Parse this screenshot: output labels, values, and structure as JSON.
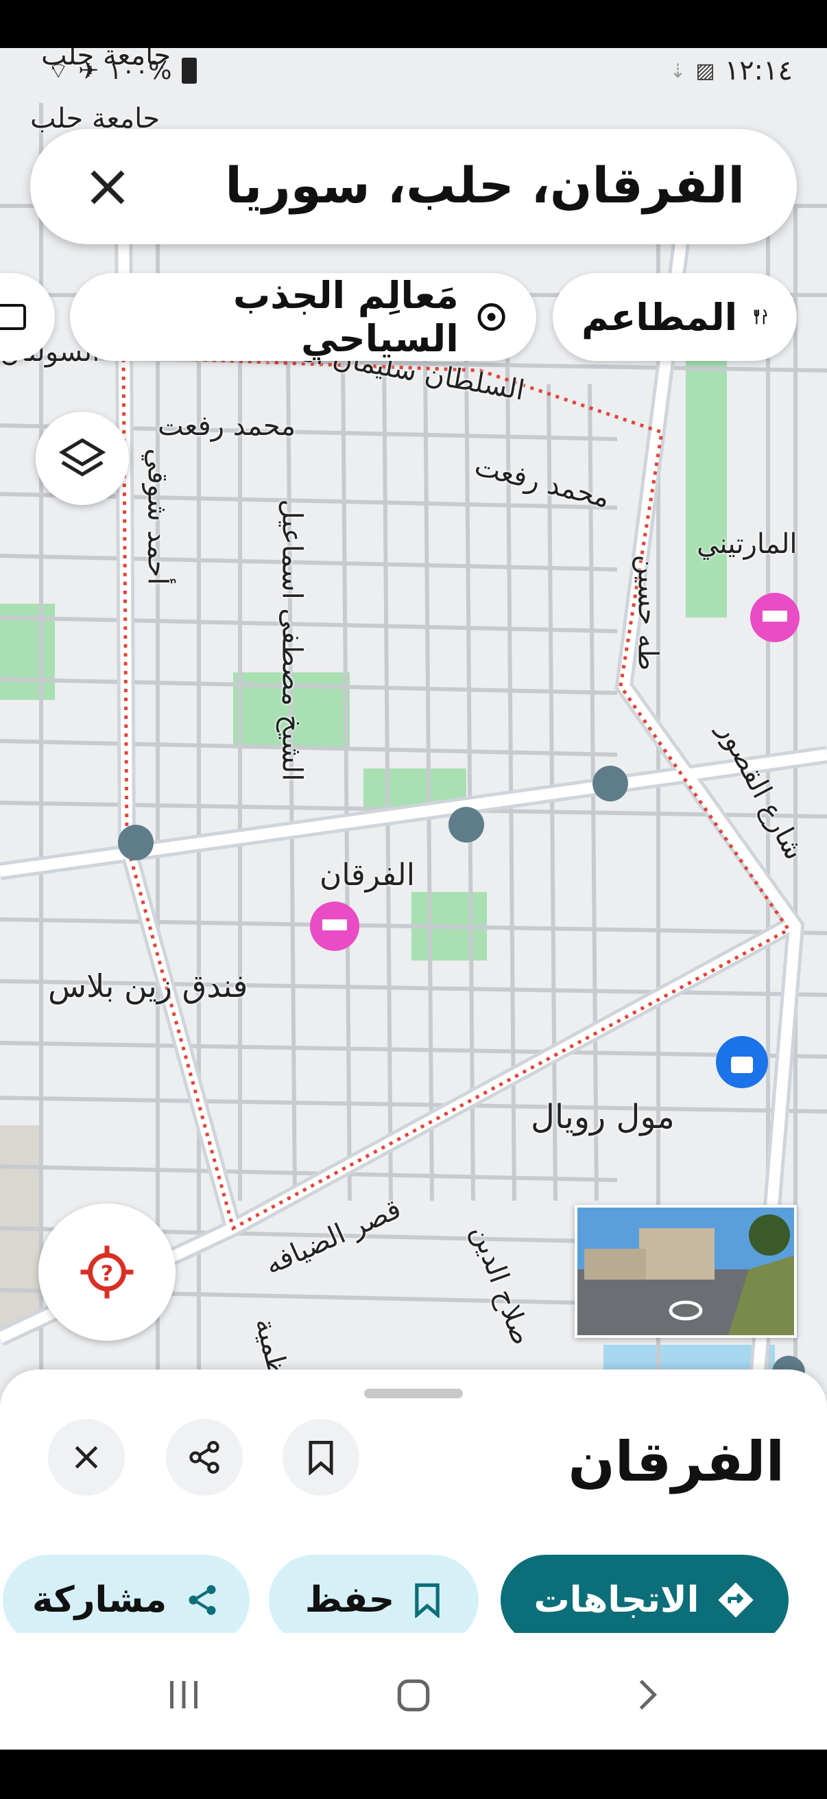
{
  "status_bar": {
    "time": "١٢:١٤",
    "battery": "١٠٠%"
  },
  "search": {
    "query": "الفرقان، حلب، سوريا"
  },
  "chips": [
    {
      "label": "المطاعم",
      "icon": "restaurant-icon"
    },
    {
      "label": "مَعالِم الجذب السياحي",
      "icon": "attraction-icon"
    }
  ],
  "map_labels": {
    "top_cut_1": "جامعة حلب",
    "top_cut_2": "جامعة حلب",
    "street_suleiman": "السلطان سليمان القانوني",
    "street_rifaat_1": "محمد رفعت",
    "street_rifaat_2": "محمد رفعت",
    "street_mustafa": "الشيخ مصطفى اسماعيل",
    "street_hussein": "طه حسين",
    "street_partial_left": "أحمد شوقي",
    "street_partial_topleft": "السولتان",
    "area_martini": "المارتيني",
    "street_qusour": "شارع القصور",
    "neighborhood": "الفرقان",
    "hotel": "فندق زين بلاس",
    "mall": "مول رويال",
    "street_qasr": "قصر الضيافه",
    "street_salah": "صلاح الدين",
    "street_azamiya": "الأعظمية"
  },
  "place": {
    "title": "الفرقان"
  },
  "actions": {
    "directions": "الاتجاهات",
    "save": "حفظ",
    "share": "مشاركة"
  },
  "colors": {
    "accent": "#0b6e78",
    "chip_light": "#d5f1f7",
    "boundary": "#e0453a",
    "hotel_pin": "#e94cc4",
    "mall_pin": "#1a73e8",
    "transit": "#5f7c8a"
  }
}
